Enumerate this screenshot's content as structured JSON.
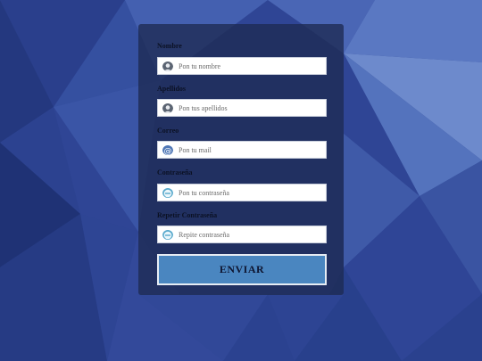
{
  "form": {
    "fields": [
      {
        "label": "Nombre",
        "placeholder": "Pon tu nombre",
        "value": "",
        "icon": "user-icon"
      },
      {
        "label": "Apellidos",
        "placeholder": "Pon tus apellidos",
        "value": "",
        "icon": "user-icon"
      },
      {
        "label": "Correo",
        "placeholder": "Pon tu mail",
        "value": "",
        "icon": "at-sign-icon"
      },
      {
        "label": "Contraseña",
        "placeholder": "Pon tu contraseña",
        "value": "",
        "icon": "key-icon"
      },
      {
        "label": "Repetir Contraseña",
        "placeholder": "Repite contraseña",
        "value": "",
        "icon": "key-icon"
      }
    ],
    "submit_label": "ENVIAR"
  },
  "colors": {
    "background": "#2f4595",
    "panel": "#1e2a52",
    "button": "#4a86c0",
    "button_text": "#0e1530",
    "label_text": "#0b1124"
  }
}
